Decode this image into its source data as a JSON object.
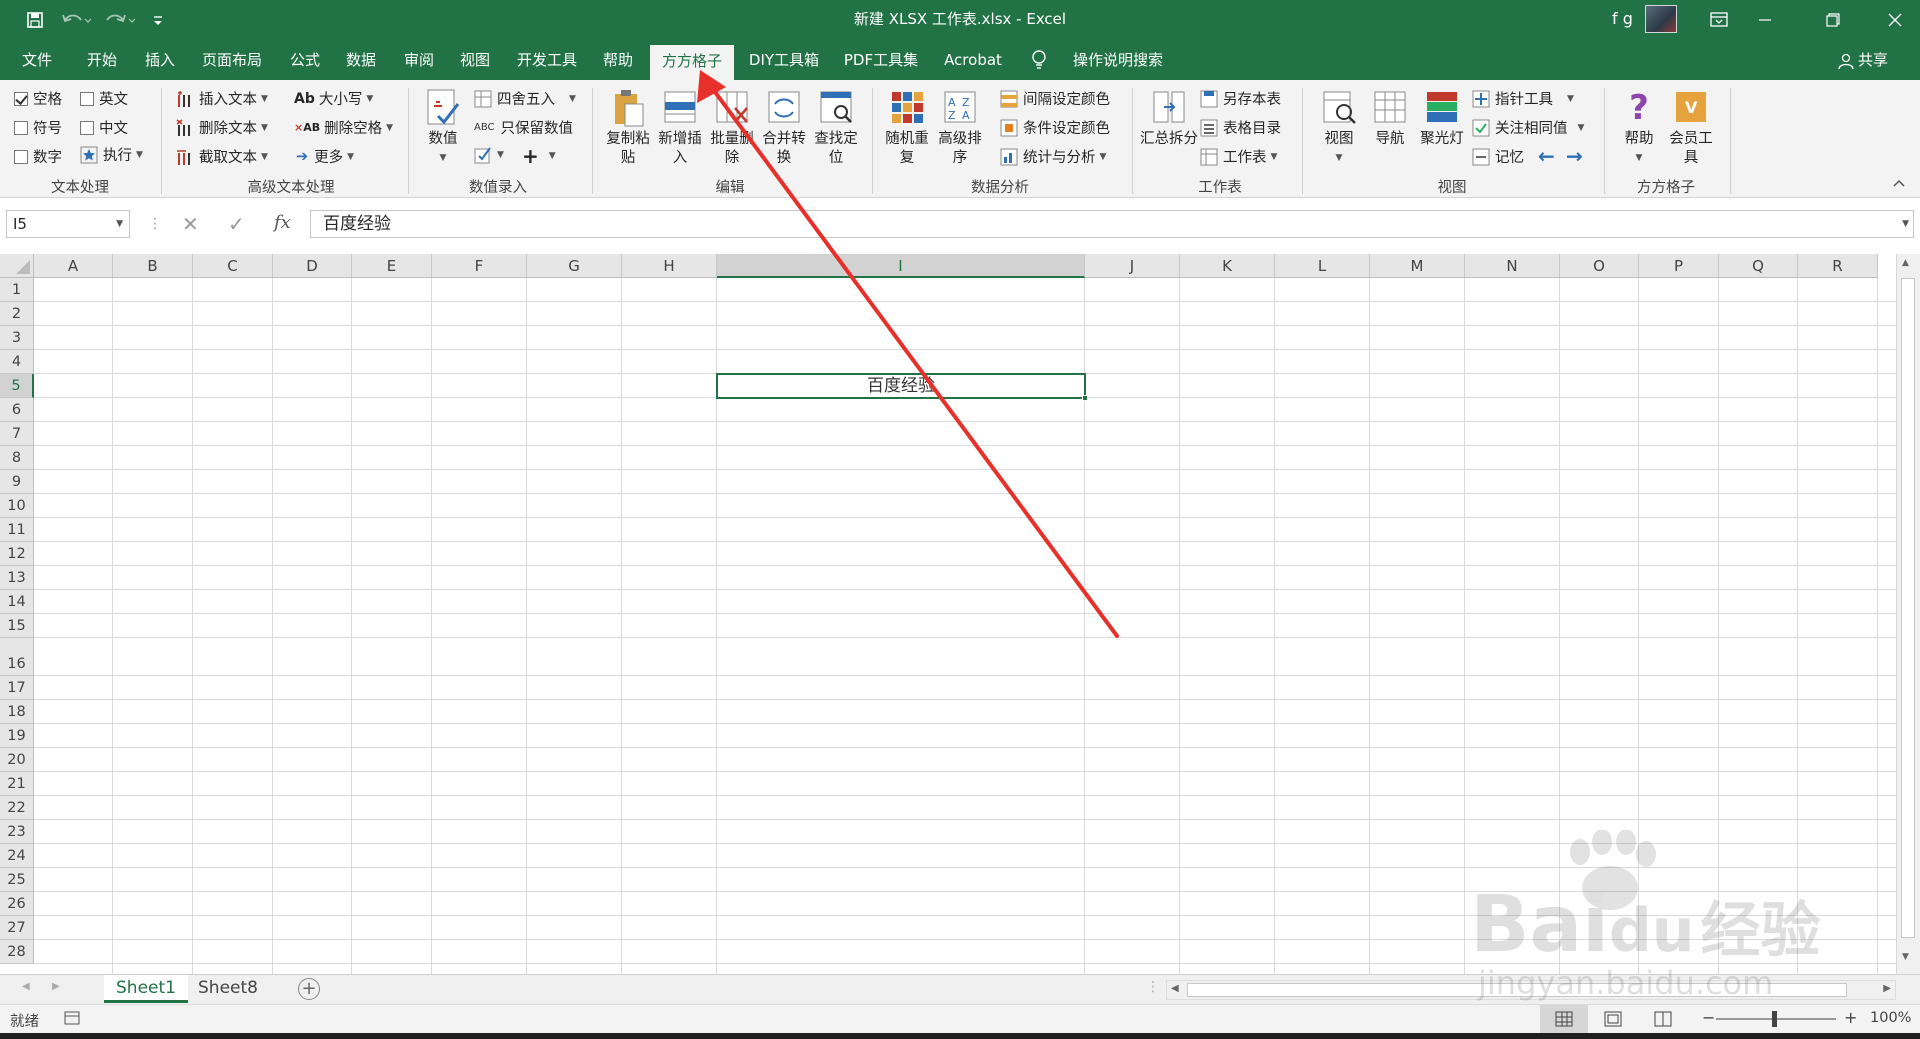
{
  "window": {
    "title": "新建 XLSX 工作表.xlsx  -  Excel",
    "user": "f g"
  },
  "tabs": [
    "文件",
    "开始",
    "插入",
    "页面布局",
    "公式",
    "数据",
    "审阅",
    "视图",
    "开发工具",
    "帮助",
    "方方格子",
    "DIY工具箱",
    "PDF工具集",
    "Acrobat"
  ],
  "active_tab": "方方格子",
  "tell_me": "操作说明搜索",
  "share": "共享",
  "ribbon": {
    "text_proc": {
      "checks": [
        {
          "label": "空格",
          "checked": true
        },
        {
          "label": "英文",
          "checked": false
        },
        {
          "label": "符号",
          "checked": false
        },
        {
          "label": "中文",
          "checked": false
        },
        {
          "label": "数字",
          "checked": false
        }
      ],
      "exec": "执行",
      "group": "文本处理"
    },
    "adv_text": {
      "insert": "插入文本",
      "delete": "删除文本",
      "extract": "截取文本",
      "case": "大小写",
      "del_space": "删除空格",
      "more": "更多",
      "group": "高级文本处理"
    },
    "num_entry": {
      "value": "数值",
      "round": "四舍五入",
      "keep": "只保留数值",
      "group": "数值录入"
    },
    "edit": {
      "paste": "复制粘贴",
      "new_insert": "新增插入",
      "batch_del": "批量删除",
      "merge": "合并转换",
      "find": "查找定位",
      "group": "编辑"
    },
    "data_anal": {
      "random": "随机重复",
      "sort": "高级排序",
      "interval": "间隔设定颜色",
      "cond": "条件设定颜色",
      "stats": "统计与分析",
      "group": "数据分析"
    },
    "sheet": {
      "summary": "汇总拆分",
      "save_as": "另存本表",
      "catalog": "表格目录",
      "worksheet": "工作表",
      "group": "工作表"
    },
    "view": {
      "view": "视图",
      "nav": "导航",
      "spot": "聚光灯",
      "pointer": "指针工具",
      "follow": "关注相同值",
      "memory": "记忆",
      "group": "视图"
    },
    "ffgz": {
      "help": "帮助",
      "member": "会员工具",
      "group": "方方格子"
    }
  },
  "formula_bar": {
    "cell_ref": "I5",
    "value": "百度经验"
  },
  "columns": [
    "A",
    "B",
    "C",
    "D",
    "E",
    "F",
    "G",
    "H",
    "I",
    "J",
    "K",
    "L",
    "M",
    "N",
    "O",
    "P",
    "Q",
    "R"
  ],
  "rows": [
    "1",
    "2",
    "3",
    "4",
    "5",
    "6",
    "7",
    "8",
    "9",
    "10",
    "11",
    "12",
    "13",
    "14",
    "15",
    "16",
    "17",
    "18",
    "19",
    "20",
    "21",
    "22",
    "23",
    "24",
    "25",
    "26",
    "27",
    "28"
  ],
  "cell": {
    "value": "百度经验"
  },
  "sheets": [
    "Sheet1",
    "Sheet8"
  ],
  "active_sheet": "Sheet1",
  "status": {
    "ready": "就绪",
    "zoom": "100%"
  },
  "watermark": {
    "brand": "Bai",
    "brand2": "du",
    "cn": "经验",
    "url": "jingyan.baidu.com"
  },
  "colors": {
    "excel_green": "#217346",
    "annotation": "#e8302a"
  }
}
